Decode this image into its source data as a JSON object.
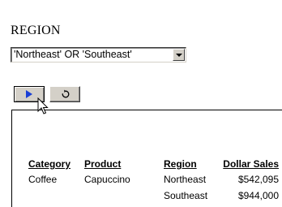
{
  "filter": {
    "label": "REGION",
    "selected_value": "'Northeast' OR 'Southeast'"
  },
  "buttons": {
    "run_icon": "play-icon",
    "reset_icon": "reset-icon"
  },
  "report": {
    "headers": [
      "Category",
      "Product",
      "Region",
      "Dollar Sales"
    ],
    "rows": [
      {
        "category": "Coffee",
        "product": "Capuccino",
        "region": "Northeast",
        "sales": "$542,095"
      },
      {
        "category": "",
        "product": "",
        "region": "Southeast",
        "sales": "$944,000"
      }
    ]
  },
  "colors": {
    "play_icon": "#1a3fd6",
    "button_face": "#d4d0c8"
  }
}
